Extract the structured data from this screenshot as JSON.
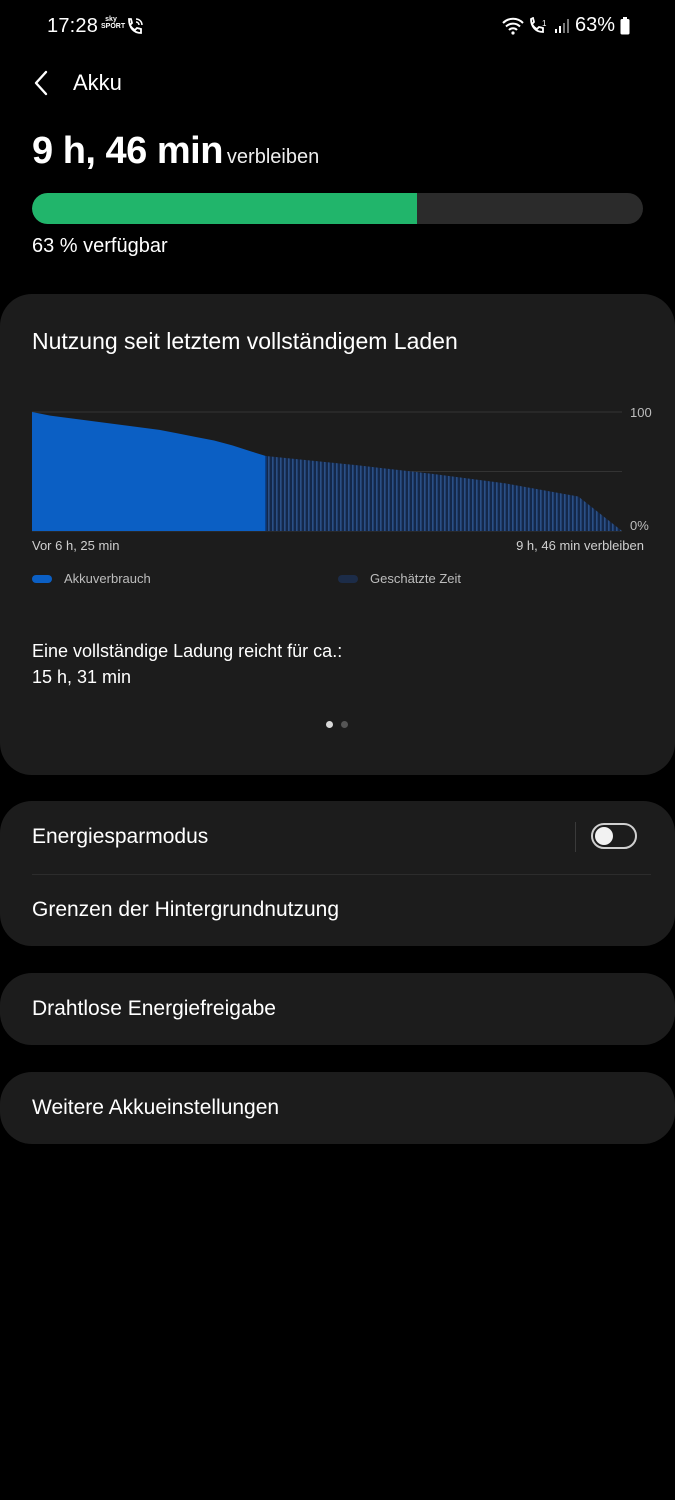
{
  "status_bar": {
    "time": "17:28",
    "sky_badge": "sky SPORT",
    "battery_percent": "63%"
  },
  "header": {
    "title": "Akku"
  },
  "battery": {
    "remaining_time": "9 h, 46 min",
    "remaining_suffix": "verbleiben",
    "level_percent": 63,
    "available_text": "63 % verfügbar",
    "bar_color": "#21b56b"
  },
  "usage": {
    "title": "Nutzung seit letztem vollständigem Laden",
    "full_charge_label": "Eine vollständige Ladung reicht für ca.:",
    "full_charge_value": "15 h, 31 min",
    "page_dots": 2,
    "active_dot": 0
  },
  "chart_data": {
    "type": "area",
    "x_start_label": "Vor 6 h, 25 min",
    "x_end_label": "9 h, 46 min verbleiben",
    "y_labels": [
      "100",
      "0%"
    ],
    "ylim": [
      0,
      100
    ],
    "series": [
      {
        "name": "Akkuverbrauch",
        "color": "#0b5fc4",
        "points": [
          [
            0,
            100
          ],
          [
            0.5,
            97
          ],
          [
            1,
            95
          ],
          [
            1.5,
            93
          ],
          [
            2,
            91
          ],
          [
            2.5,
            89
          ],
          [
            3,
            87
          ],
          [
            3.5,
            85
          ],
          [
            4,
            82
          ],
          [
            4.5,
            79
          ],
          [
            5,
            76
          ],
          [
            5.5,
            72
          ],
          [
            6,
            67
          ],
          [
            6.42,
            63
          ]
        ]
      },
      {
        "name": "Geschätzte Zeit",
        "color": "#1c3b67",
        "points": [
          [
            6.42,
            63
          ],
          [
            9,
            55
          ],
          [
            11,
            48
          ],
          [
            13,
            40
          ],
          [
            15,
            29
          ],
          [
            16.2,
            0
          ]
        ]
      }
    ],
    "grid": true,
    "legend_position": "bottom"
  },
  "settings": {
    "power_saving": {
      "label": "Energiesparmodus",
      "enabled": false
    },
    "background_limits": {
      "label": "Grenzen der Hintergrundnutzung"
    },
    "wireless_powershare": {
      "label": "Drahtlose Energiefreigabe"
    },
    "more_settings": {
      "label": "Weitere Akkueinstellungen"
    }
  }
}
